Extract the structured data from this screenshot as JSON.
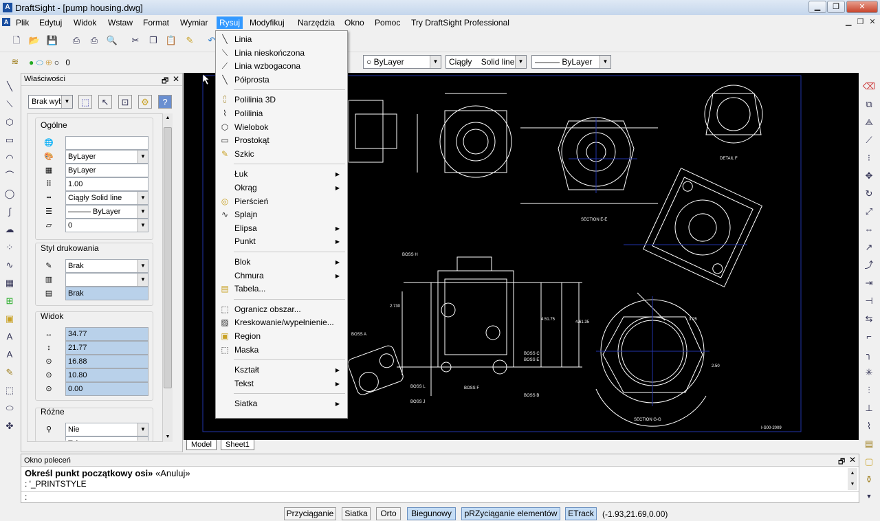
{
  "window": {
    "title": "DraftSight - [pump housing.dwg]",
    "icon": "draftsight-logo-icon"
  },
  "menubar": {
    "items": [
      "Plik",
      "Edytuj",
      "Widok",
      "Wstaw",
      "Format",
      "Wymiar",
      "Rysuj",
      "Modyfikuj",
      "Narzędzia",
      "Okno",
      "Pomoc",
      "Try DraftSight Professional"
    ],
    "selected": "Rysuj"
  },
  "layerbar": {
    "layer": "0"
  },
  "propbar": {
    "color": "ByLayer",
    "linetype_name": "Ciągły",
    "linetype_desc": "Solid line",
    "lineweight": "ByLayer"
  },
  "properties": {
    "title": "Właściwości",
    "selection": "Brak wyb",
    "groups": {
      "general": {
        "title": "Ogólne",
        "rows": [
          "",
          "ByLayer",
          "ByLayer",
          "1.00",
          "Ciągły    Solid line",
          "——— ByLayer",
          "0"
        ]
      },
      "print": {
        "title": "Styl drukowania",
        "rows": [
          "Brak",
          "",
          "Brak"
        ]
      },
      "view": {
        "title": "Widok",
        "rows": [
          "34.77",
          "21.77",
          "16.88",
          "10.80",
          "0.00"
        ]
      },
      "misc": {
        "title": "Różne",
        "rows": [
          "Nie",
          "Tak"
        ]
      }
    }
  },
  "tabs": [
    "Model",
    "Sheet1"
  ],
  "drawing": {
    "labels": [
      "SECTION E-E",
      "DETAIL F",
      "SECTION G-G",
      "BOSS H",
      "BOSS A",
      "BOSS B",
      "BOSS C",
      "BOSS E",
      "BOSS F",
      "BOSS L",
      "BOSS J",
      "2.730",
      "4.51.75",
      "4.61.35",
      "3.25",
      "2.50",
      "I-S00-2009"
    ]
  },
  "command": {
    "title": "Okno poleceń",
    "line1_bold": "Określ punkt początkowy osi»",
    "line1_rest": " «Anuluj»",
    "line2": ": '_PRINTSTYLE",
    "line3": ":"
  },
  "status": {
    "buttons": [
      "Przyciąganie",
      "Siatka",
      "Orto",
      "Biegunowy",
      "pRZyciąganie elementów",
      "ETrack"
    ],
    "active": [
      "Biegunowy",
      "pRZyciąganie elementów",
      "ETrack"
    ],
    "coords": "(-1.93,21.69,0.00)"
  },
  "draw_menu": {
    "sections": [
      [
        {
          "label": "Linia",
          "icon": "line-icon"
        },
        {
          "label": "Linia nieskończona",
          "icon": "infinite-line-icon"
        },
        {
          "label": "Linia wzbogacona",
          "icon": "smart-line-icon"
        },
        {
          "label": "Półprosta",
          "icon": "ray-icon"
        }
      ],
      [
        {
          "label": "Polilinia 3D",
          "icon": "polyline-3d-icon"
        },
        {
          "label": "Polilinia",
          "icon": "polyline-icon"
        },
        {
          "label": "Wielobok",
          "icon": "polygon-icon"
        },
        {
          "label": "Prostokąt",
          "icon": "rectangle-icon"
        },
        {
          "label": "Szkic",
          "icon": "sketch-icon"
        }
      ],
      [
        {
          "label": "Łuk",
          "sub": true
        },
        {
          "label": "Okrąg",
          "sub": true
        },
        {
          "label": "Pierścień",
          "icon": "donut-icon"
        },
        {
          "label": "Splajn",
          "icon": "spline-icon"
        },
        {
          "label": "Elipsa",
          "sub": true
        },
        {
          "label": "Punkt",
          "sub": true
        }
      ],
      [
        {
          "label": "Blok",
          "sub": true
        },
        {
          "label": "Chmura",
          "sub": true
        },
        {
          "label": "Tabela...",
          "icon": "table-icon"
        }
      ],
      [
        {
          "label": "Ogranicz obszar...",
          "icon": "boundary-icon"
        },
        {
          "label": "Kreskowanie/wypełnienie...",
          "icon": "hatch-icon"
        },
        {
          "label": "Region",
          "icon": "region-icon"
        },
        {
          "label": "Maska",
          "icon": "mask-icon"
        }
      ],
      [
        {
          "label": "Kształt",
          "sub": true
        },
        {
          "label": "Tekst",
          "sub": true
        }
      ],
      [
        {
          "label": "Siatka",
          "sub": true
        }
      ]
    ]
  },
  "colors": {
    "menu_highlight": "#3399ff",
    "canvas_bg": "#000000",
    "drawing_lines": "#ffffff",
    "border_frame": "#2233aa",
    "status_active": "#c5ddf5"
  }
}
